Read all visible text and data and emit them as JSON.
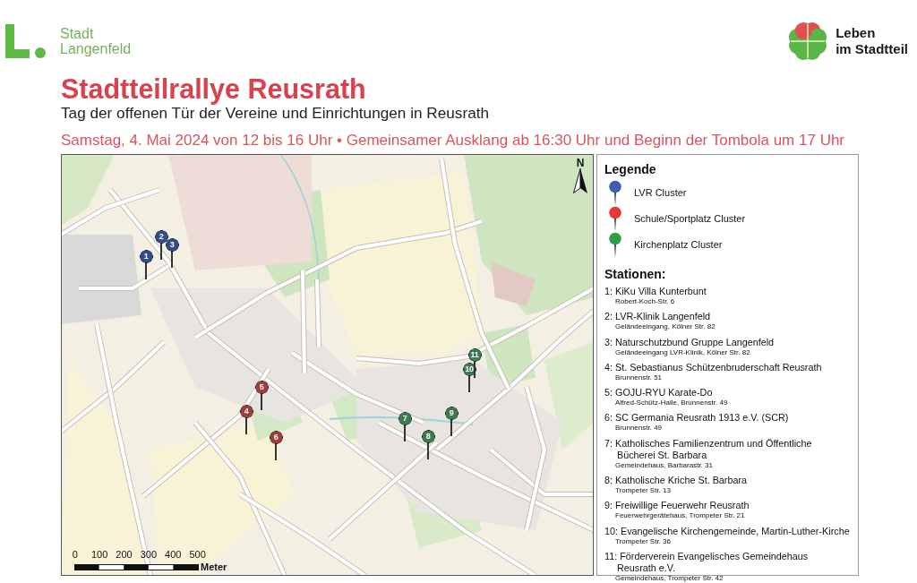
{
  "header": {
    "logo_left": {
      "lines": [
        "Stadt",
        "Langenfeld"
      ]
    },
    "logo_right": {
      "lines": [
        "Leben",
        "im Stadtteil"
      ]
    }
  },
  "title": "Stadtteilrallye Reusrath",
  "subtitle": "Tag der offenen Tür der Vereine und Einrichtungen in Reusrath",
  "date_line": "Samstag, 4. Mai 2024 von 12 bis 16 Uhr • Gemeinsamer Ausklang ab 16:30 Uhr und Beginn der Tombola um 17 Uhr",
  "map": {
    "compass": "N",
    "pins": [
      {
        "label": "1",
        "color": "#2f4d8f"
      },
      {
        "label": "2",
        "color": "#2f4d8f"
      },
      {
        "label": "3",
        "color": "#2f4d8f"
      },
      {
        "label": "4",
        "color": "#a53c3c"
      },
      {
        "label": "5",
        "color": "#a53c3c"
      },
      {
        "label": "6",
        "color": "#a53c3c"
      },
      {
        "label": "7",
        "color": "#3c7a52"
      },
      {
        "label": "8",
        "color": "#3c7a52"
      },
      {
        "label": "9",
        "color": "#3c7a52"
      },
      {
        "label": "10",
        "color": "#3c7a52"
      },
      {
        "label": "11",
        "color": "#3c7a52"
      }
    ],
    "scale_bar": {
      "ticks": [
        "0",
        "100",
        "200",
        "300",
        "400",
        "500"
      ],
      "unit": "Meter"
    }
  },
  "legend": {
    "title": "Legende",
    "clusters": [
      {
        "label": "LVR Cluster",
        "color": "#3e5fb0"
      },
      {
        "label": "Schule/Sportplatz Cluster",
        "color": "#e53935"
      },
      {
        "label": "Kirchenplatz Cluster",
        "color": "#2f9e45"
      }
    ],
    "stations_title": "Stationen:",
    "stations": [
      {
        "name": "1: KiKu Villa Kunterbunt",
        "address": "Robert-Koch-Str. 6"
      },
      {
        "name": "2: LVR-Klinik Langenfeld",
        "address": "Geländeeingang, Kölner Str. 82"
      },
      {
        "name": "3: Naturschutzbund Gruppe Langenfeld",
        "address": "Geländeeingang LVR-Klinik, Kölner Str. 82"
      },
      {
        "name": "4: St. Sebastianus Schützenbruderschaft Reusrath",
        "address": "Brunnenstr. 51"
      },
      {
        "name": "5: GOJU-RYU Karate-Do",
        "address": "Alfred-Schütz-Halle, Brunnenstr. 49"
      },
      {
        "name": "6: SC Germania Reusrath 1913 e.V. (SCR)",
        "address": "Brunnenstr. 49"
      },
      {
        "name": "7: Katholisches Familienzentrum und Öffentliche\nBücherei St. Barbara",
        "address": "Gemeindehaus, Barbarastr. 31"
      },
      {
        "name": "8: Katholische Kriche St. Barbara",
        "address": "Trompeter Str. 13"
      },
      {
        "name": "9: Freiwillige Feuerwehr Reusrath",
        "address": "Feuerwehrgerätehaus, Trompeter Str. 21"
      },
      {
        "name": "10: Evangelische Kirchengemeinde, Martin-Luther-Kirche",
        "address": "Trompeter Str. 36"
      },
      {
        "name": "11: Förderverein Evangelisches Gemeindehaus\nReusrath e.V.",
        "address": "Gemeindehaus, Trompeter Str. 42"
      }
    ]
  }
}
